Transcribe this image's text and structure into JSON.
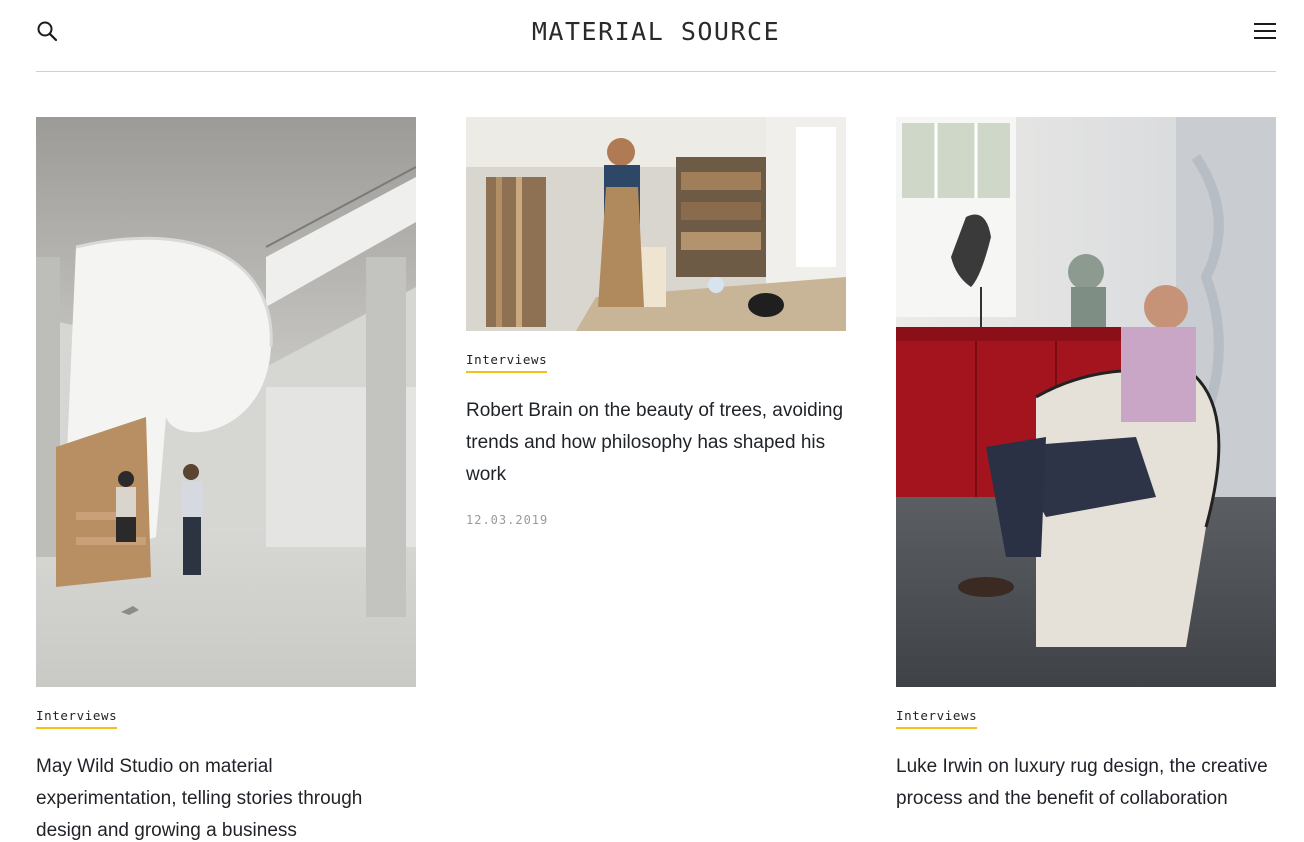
{
  "header": {
    "logo": "MATERIAL SOURCE",
    "icons": {
      "search": "search-icon",
      "menu": "hamburger-menu-icon"
    }
  },
  "cards": [
    {
      "category": "Interviews",
      "title": "May Wild Studio on material experimentation, telling stories through design and growing a business",
      "date": ""
    },
    {
      "category": "Interviews",
      "title": "Robert Brain on the beauty of trees, avoiding trends and how philosophy has shaped his work",
      "date": "12.03.2019"
    },
    {
      "category": "Interviews",
      "title": "Luke Irwin on luxury rug design, the creative process and the benefit of collaboration",
      "date": ""
    }
  ],
  "colors": {
    "accent_underline": "#f2c21a",
    "text": "#1f2328",
    "date_grey": "#9a9a9a",
    "divider": "#cfcfcf"
  }
}
